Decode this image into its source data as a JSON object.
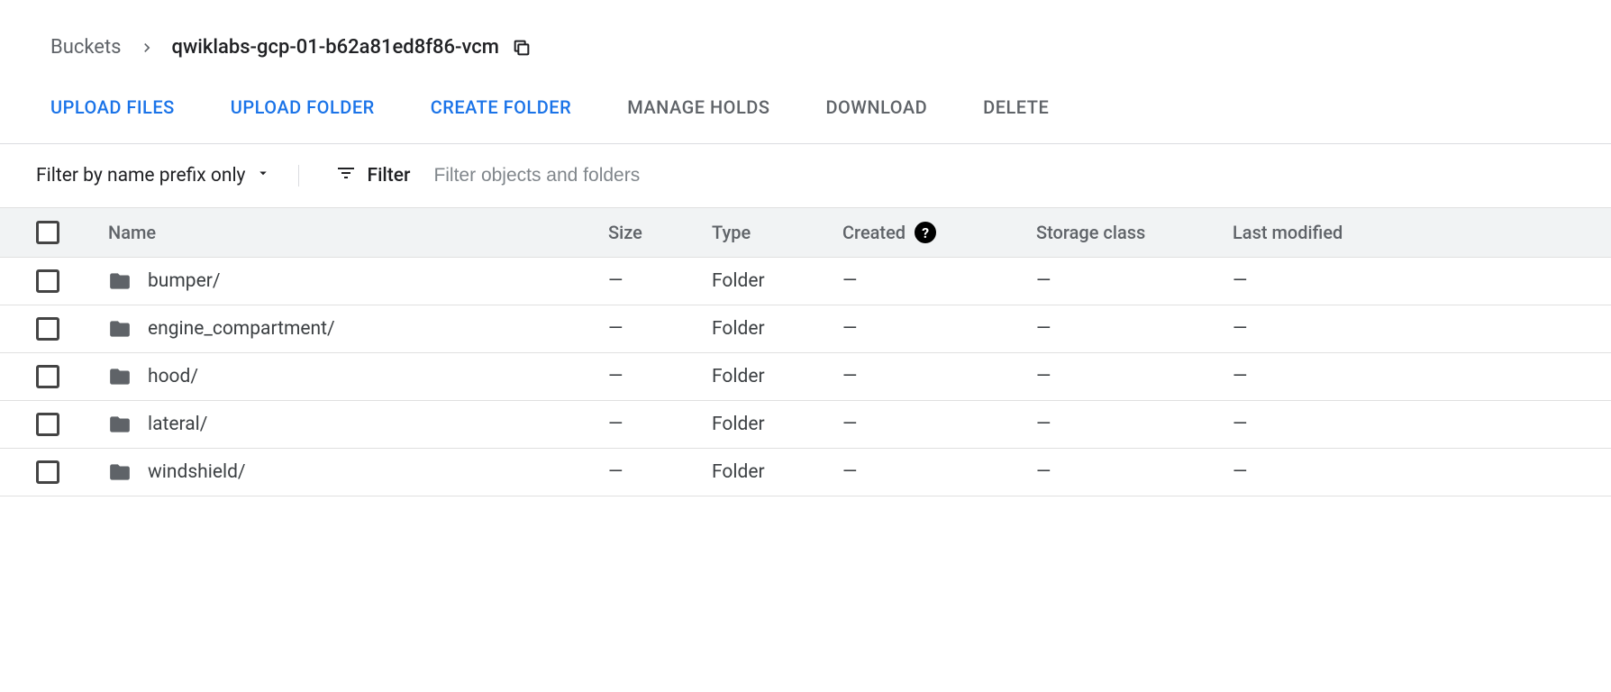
{
  "breadcrumb": {
    "root": "Buckets",
    "current": "qwiklabs-gcp-01-b62a81ed8f86-vcm"
  },
  "actions": {
    "upload_files": "UPLOAD FILES",
    "upload_folder": "UPLOAD FOLDER",
    "create_folder": "CREATE FOLDER",
    "manage_holds": "MANAGE HOLDS",
    "download": "DOWNLOAD",
    "delete": "DELETE"
  },
  "filter": {
    "prefix_label": "Filter by name prefix only",
    "filter_label": "Filter",
    "placeholder": "Filter objects and folders"
  },
  "columns": {
    "name": "Name",
    "size": "Size",
    "type": "Type",
    "created": "Created",
    "storage_class": "Storage class",
    "last_modified": "Last modified"
  },
  "rows": [
    {
      "name": "bumper/",
      "size": "—",
      "type": "Folder",
      "created": "—",
      "storage_class": "—",
      "last_modified": "—"
    },
    {
      "name": "engine_compartment/",
      "size": "—",
      "type": "Folder",
      "created": "—",
      "storage_class": "—",
      "last_modified": "—"
    },
    {
      "name": "hood/",
      "size": "—",
      "type": "Folder",
      "created": "—",
      "storage_class": "—",
      "last_modified": "—"
    },
    {
      "name": "lateral/",
      "size": "—",
      "type": "Folder",
      "created": "—",
      "storage_class": "—",
      "last_modified": "—"
    },
    {
      "name": "windshield/",
      "size": "—",
      "type": "Folder",
      "created": "—",
      "storage_class": "—",
      "last_modified": "—"
    }
  ]
}
